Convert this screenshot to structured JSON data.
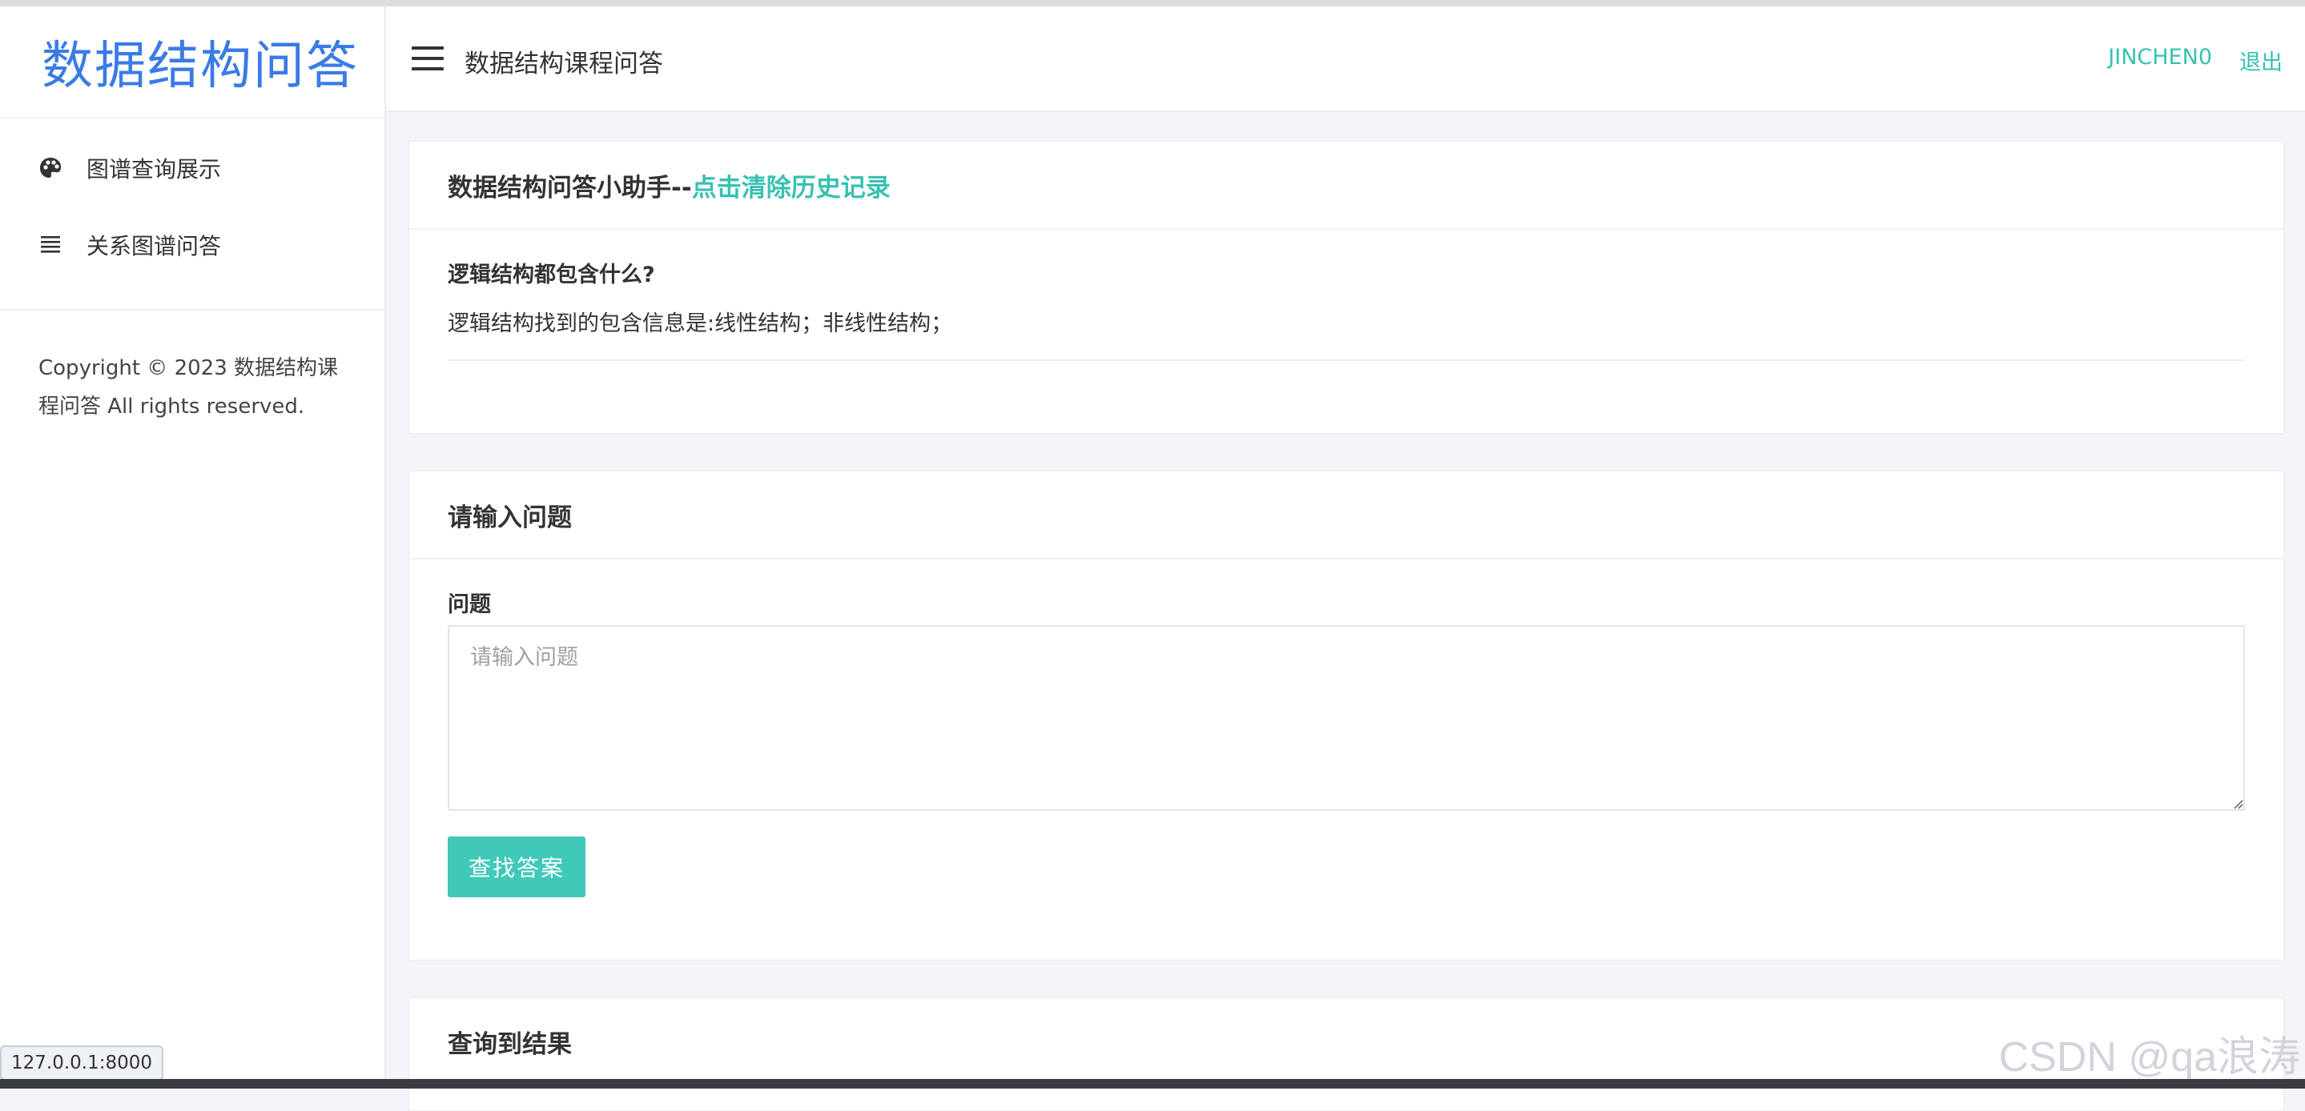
{
  "sidebar": {
    "brand": "数据结构问答",
    "items": [
      {
        "label": "图谱查询展示",
        "icon": "palette-icon"
      },
      {
        "label": "关系图谱问答",
        "icon": "list-icon"
      }
    ],
    "copyright": "Copyright © 2023 数据结构课程问答 All rights reserved."
  },
  "topbar": {
    "menu_icon": "hamburger-icon",
    "title": "数据结构课程问答",
    "user": "JINCHEN0",
    "logout": "退出"
  },
  "chat_card": {
    "title": "数据结构问答小助手--",
    "clear_link": "点击清除历史记录",
    "question": "逻辑结构都包含什么?",
    "answer": "逻辑结构找到的包含信息是:线性结构；非线性结构；"
  },
  "input_card": {
    "title": "请输入问题",
    "field_label": "问题",
    "placeholder": "请输入问题",
    "value": "",
    "submit_label": "查找答案"
  },
  "result_card": {
    "title": "查询到结果"
  },
  "status_bar": {
    "url": "127.0.0.1:8000"
  },
  "watermark": "CSDN @qa浪涛",
  "colors": {
    "accent": "#36c1b2",
    "brand": "#3a7be6",
    "button": "#40c9b9"
  }
}
